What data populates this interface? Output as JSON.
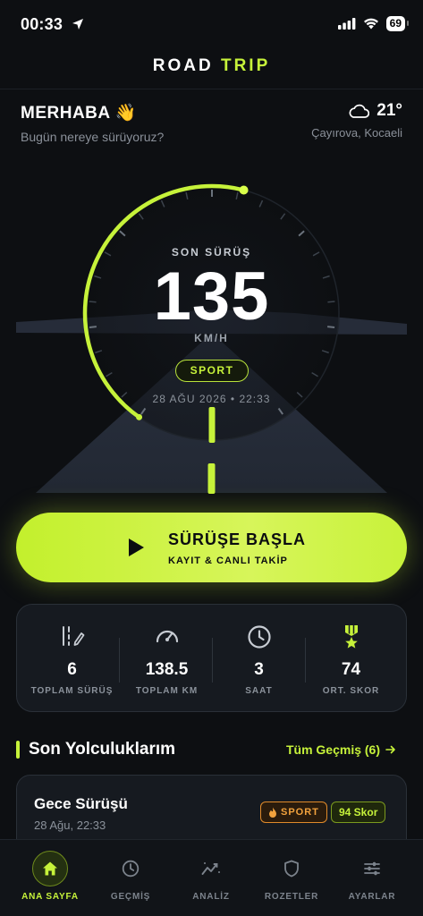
{
  "status": {
    "time": "00:33",
    "battery": "69"
  },
  "app": {
    "title_part1": "ROAD",
    "title_part2": "TRIP"
  },
  "greeting": {
    "title": "MERHABA 👋",
    "subtitle": "Bugün nereye sürüyoruz?"
  },
  "weather": {
    "temperature": "21°",
    "location": "Çayırova, Kocaeli",
    "icon": "cloud-icon"
  },
  "gauge": {
    "label": "SON SÜRÜŞ",
    "speed": "135",
    "unit": "KM/H",
    "mode": "SPORT",
    "date": "28 AĞU 2026 • 22:33",
    "fill_fraction": 0.55,
    "accent_color": "#c6f23a"
  },
  "start": {
    "title": "SÜRÜŞE BAŞLA",
    "subtitle": "KAYIT & CANLI TAKİP",
    "icon": "play-icon"
  },
  "stats": [
    {
      "value": "6",
      "label": "TOPLAM SÜRÜŞ",
      "icon": "route-icon"
    },
    {
      "value": "138.5",
      "label": "TOPLAM KM",
      "icon": "speedometer-icon"
    },
    {
      "value": "3",
      "label": "SAAT",
      "icon": "clock-icon"
    },
    {
      "value": "74",
      "label": "ORT. SKOR",
      "icon": "medal-icon"
    }
  ],
  "recent": {
    "title": "Son Yolculuklarım",
    "link": "Tüm Geçmiş (6)",
    "trips": [
      {
        "name": "Gece Sürüşü",
        "date": "28 Ağu, 22:33",
        "mode": "SPORT",
        "score": "94 Skor"
      }
    ]
  },
  "tabs": [
    {
      "label": "ANA SAYFA",
      "icon": "home-icon",
      "active": true
    },
    {
      "label": "GEÇMİŞ",
      "icon": "clock-icon"
    },
    {
      "label": "ANALİZ",
      "icon": "chart-icon"
    },
    {
      "label": "ROZETLER",
      "icon": "shield-icon"
    },
    {
      "label": "AYARLAR",
      "icon": "sliders-icon"
    }
  ],
  "colors": {
    "accent": "#c6f23a",
    "background": "#0d0f12",
    "card": "#161a20",
    "sport_orange": "#f2a23d"
  }
}
